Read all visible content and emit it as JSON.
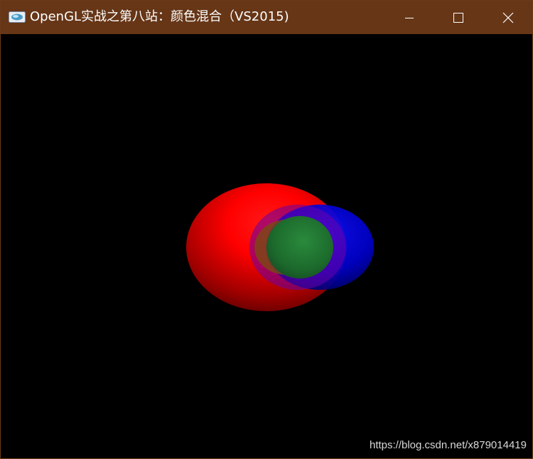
{
  "window": {
    "title": "OpenGL实战之第八站：颜色混合（VS2015)",
    "titlebar_color": "#663617",
    "controls": {
      "minimize_icon": "minimize-icon",
      "maximize_icon": "maximize-icon",
      "close_icon": "close-icon"
    }
  },
  "scene": {
    "background": "#000000",
    "objects": [
      {
        "name": "red-sphere",
        "color": "#ff0000"
      },
      {
        "name": "blue-sphere",
        "color": "#0000ff"
      },
      {
        "name": "green-sphere",
        "color": "#1f7a34"
      }
    ]
  },
  "watermark": {
    "text": "https://blog.csdn.net/x879014419"
  }
}
